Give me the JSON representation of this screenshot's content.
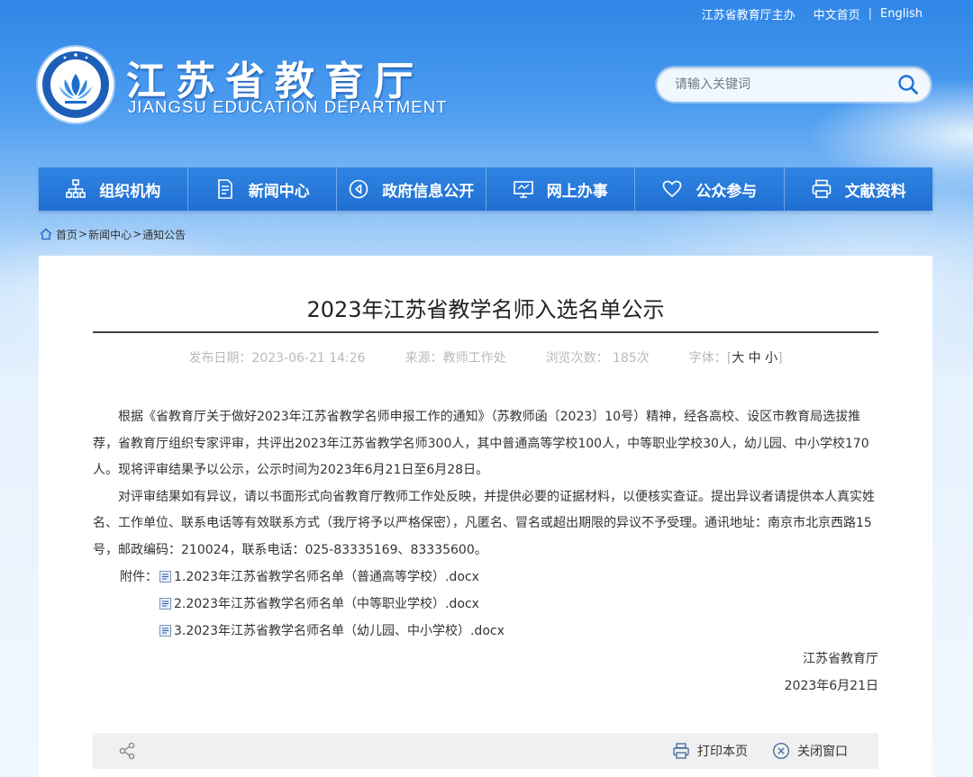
{
  "toplinks": {
    "host": "江苏省教育厅主办",
    "home": "中文首页",
    "separator": "|",
    "english": "English"
  },
  "logo": {
    "title": "江苏省教育厅",
    "subtitle": "JIANGSU EDUCATION DEPARTMENT"
  },
  "search": {
    "placeholder": "请输入关键词"
  },
  "nav": {
    "items": [
      {
        "label": "组织机构",
        "icon": "org-chart-icon"
      },
      {
        "label": "新闻中心",
        "icon": "document-icon"
      },
      {
        "label": "政府信息公开",
        "icon": "speaker-icon"
      },
      {
        "label": "网上办事",
        "icon": "monitor-icon"
      },
      {
        "label": "公众参与",
        "icon": "heart-icon"
      },
      {
        "label": "文献资料",
        "icon": "printer-icon"
      }
    ]
  },
  "breadcrumb": {
    "home": "首页",
    "sep": ">",
    "news": "新闻中心",
    "current": "通知公告"
  },
  "article": {
    "title": "2023年江苏省教学名师入选名单公示",
    "meta": {
      "date": "发布日期：2023-06-21 14:26",
      "source": "来源：教师工作处",
      "views": "浏览次数：  185次",
      "font_label": "字体：",
      "font_open": "[",
      "font_large": "大",
      "font_medium": "中",
      "font_small": "小",
      "font_close": "]"
    },
    "paragraphs": [
      "根据《省教育厅关于做好2023年江苏省教学名师申报工作的通知》（苏教师函〔2023〕10号）精神，经各高校、设区市教育局选拔推荐，省教育厅组织专家评审，共评出2023年江苏省教学名师300人，其中普通高等学校100人，中等职业学校30人，幼儿园、中小学校170人。现将评审结果予以公示，公示时间为2023年6月21日至6月28日。",
      "对评审结果如有异议，请以书面形式向省教育厅教师工作处反映，并提供必要的证据材料，以便核实查证。提出异议者请提供本人真实姓名、工作单位、联系电话等有效联系方式（我厅将予以严格保密），凡匿名、冒名或超出期限的异议不予受理。通讯地址：南京市北京西路15号，邮政编码：210024，联系电话：025-83335169、83335600。"
    ],
    "attachments_label": "附件：",
    "attachments": [
      "1.2023年江苏省教学名师名单（普通高等学校）.docx",
      "2.2023年江苏省教学名师名单（中等职业学校）.docx",
      "3.2023年江苏省教学名师名单（幼儿园、中小学校）.docx"
    ],
    "signature_org": "江苏省教育厅",
    "signature_date": "2023年6月21日"
  },
  "toolbar": {
    "share_icon": "share-icon",
    "print_label": "打印本页",
    "close_label": "关闭窗口"
  },
  "colors": {
    "nav_blue": "#1f6fd2",
    "sky_top": "#2f86e6",
    "meta_gray": "#b9b9b9"
  }
}
